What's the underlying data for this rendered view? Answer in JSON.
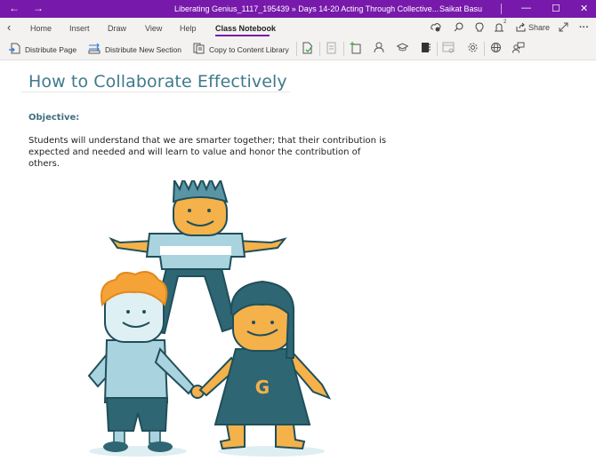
{
  "titlebar": {
    "title": "Liberating Genius_1117_195439 » Days 14-20  Acting Through Collective...",
    "user": "Saikat Basu",
    "back_icon": "back-arrow-icon",
    "forward_icon": "forward-arrow-icon",
    "minimize": "—",
    "maximize": "☐",
    "close": "✕"
  },
  "ribbon": {
    "collapse_icon": "chevron-left-icon",
    "tabs": [
      {
        "label": "Home"
      },
      {
        "label": "Insert"
      },
      {
        "label": "Draw"
      },
      {
        "label": "View"
      },
      {
        "label": "Help"
      },
      {
        "label": "Class Notebook",
        "active": true
      }
    ],
    "right": {
      "sync_icon": "sync-status-icon",
      "search_icon": "search-icon",
      "tell_me_icon": "lightbulb-icon",
      "notifications_icon": "bell-icon",
      "notifications_count": "2",
      "share_label": "Share",
      "fullscreen_icon": "expand-icon",
      "more_icon": "more-icon"
    }
  },
  "toolbar": {
    "buttons": [
      {
        "label": "Distribute Page",
        "icon": "distribute-page-icon"
      },
      {
        "label": "Distribute New Section",
        "icon": "distribute-section-icon"
      },
      {
        "label": "Copy to Content Library",
        "icon": "copy-library-icon"
      }
    ],
    "icons": [
      "review-student-work-icon",
      "assignment-icon",
      "add-page-icon",
      "student-icon",
      "graduation-cap-icon",
      "notebook-icon",
      "lms-icon",
      "settings-icon",
      "web-icon",
      "feedback-icon"
    ]
  },
  "page": {
    "title": "How to Collaborate Effectively",
    "objective_label": "Objective:",
    "body": "Students will understand that we are smarter together; that their contribution is expected and needed and will learn to value and honor the contribution of others.",
    "illustration": {
      "description": "Three cartoon kids collaborating: one standing on top of two holding hands",
      "shirt_letter": "G"
    }
  },
  "colors": {
    "accent": "#7719aa",
    "title": "#3f7a8c",
    "teal_dark": "#2f6674",
    "teal_light": "#a9d3de",
    "skin": "#f5b14a"
  }
}
